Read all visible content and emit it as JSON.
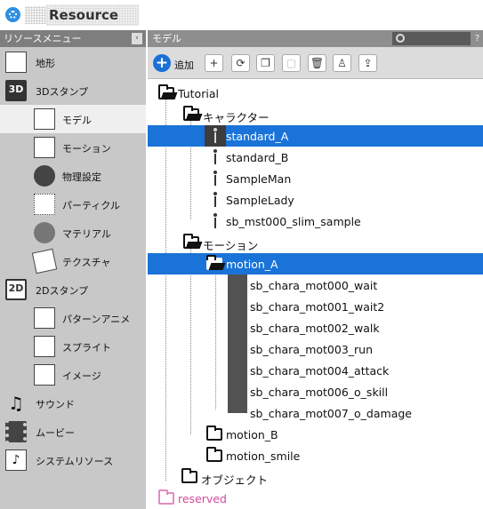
{
  "app": {
    "title": "Resource"
  },
  "left_panel": {
    "header": "リソースメニュー",
    "collapse_glyph": "‹",
    "items": [
      {
        "label": "地形",
        "icon": "terrain-icon"
      },
      {
        "label": "3Dスタンプ",
        "icon": "3d-stamp-icon",
        "badge": "3D"
      },
      {
        "label": "モデル",
        "icon": "model-icon",
        "selected": true
      },
      {
        "label": "モーション",
        "icon": "motion-icon"
      },
      {
        "label": "物理設定",
        "icon": "physics-icon"
      },
      {
        "label": "パーティクル",
        "icon": "particle-icon"
      },
      {
        "label": "マテリアル",
        "icon": "material-icon"
      },
      {
        "label": "テクスチャ",
        "icon": "texture-icon"
      },
      {
        "label": "2Dスタンプ",
        "icon": "2d-stamp-icon",
        "badge": "2D"
      },
      {
        "label": "パターンアニメ",
        "icon": "pattern-anime-icon"
      },
      {
        "label": "スプライト",
        "icon": "sprite-icon"
      },
      {
        "label": "イメージ",
        "icon": "image-icon"
      },
      {
        "label": "サウンド",
        "icon": "sound-icon",
        "glyph": "♫"
      },
      {
        "label": "ムービー",
        "icon": "movie-icon"
      },
      {
        "label": "システムリソース",
        "icon": "system-resource-icon",
        "glyph": "♪"
      }
    ]
  },
  "right_panel": {
    "header": "モデル",
    "help": "?",
    "toolbar": {
      "add_label": "追加",
      "add_glyph": "+",
      "buttons": [
        {
          "name": "new-folder-icon",
          "glyph": "+"
        },
        {
          "name": "refresh-icon",
          "glyph": "⟳"
        },
        {
          "name": "copy-icon",
          "glyph": "❐"
        },
        {
          "name": "paste-icon",
          "glyph": "▢",
          "disabled": true
        },
        {
          "name": "delete-icon",
          "glyph": "🗑"
        },
        {
          "name": "stamp-icon",
          "glyph": "♙"
        },
        {
          "name": "export-icon",
          "glyph": "⇪"
        }
      ]
    },
    "tree": {
      "root": "Tutorial",
      "character_folder": "キャラクター",
      "models": [
        "standard_A",
        "standard_B",
        "SampleMan",
        "SampleLady",
        "sb_mst000_slim_sample"
      ],
      "selected_model": "standard_A",
      "motion_folder": "モーション",
      "motion_a": "motion_A",
      "motions": [
        "sb_chara_mot000_wait",
        "sb_chara_mot001_wait2",
        "sb_chara_mot002_walk",
        "sb_chara_mot003_run",
        "sb_chara_mot004_attack",
        "sb_chara_mot006_o_skill",
        "sb_chara_mot007_o_damage"
      ],
      "motion_b": "motion_B",
      "motion_smile": "motion_smile",
      "object_folder": "オブジェクト",
      "reserved": "reserved"
    }
  },
  "colors": {
    "selection": "#1a73d8",
    "reserved": "#d14a9a",
    "accent": "#2d8fe0"
  }
}
